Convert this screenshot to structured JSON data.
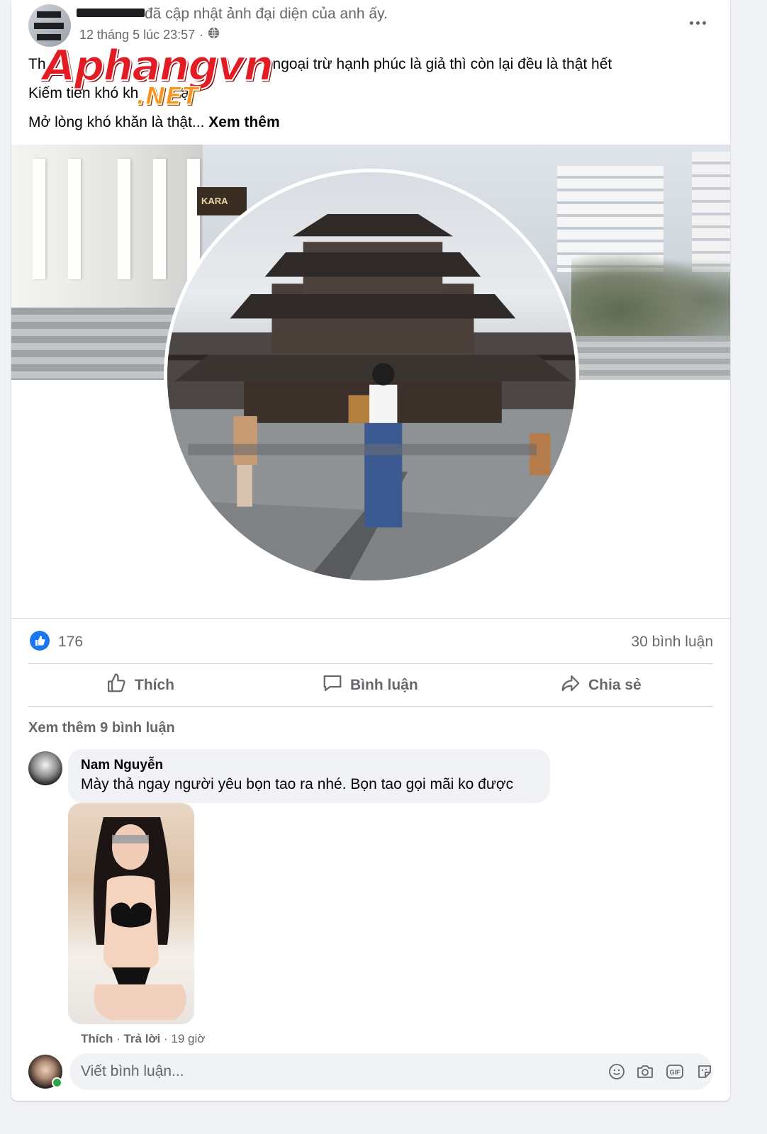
{
  "post": {
    "header_action": "đã cập nhật ảnh đại diện của anh ấy.",
    "timestamp": "12 tháng 5 lúc 23:57",
    "separator": "·",
    "audience_icon": "globe-icon",
    "more_icon": "more-horizontal-icon",
    "text_lines": [
      "ngoại trừ hạnh phúc là giả thì còn lại đều là thật hết",
      "Kiếm tiền khó kh",
      "ật",
      "Mở lòng khó khăn là thật..."
    ],
    "line1_prefix": "Th",
    "see_more": "Xem thêm"
  },
  "watermark": {
    "main": "Aphangvn",
    "suffix": ".NET"
  },
  "cover_photo": {
    "sign_text": "KARA"
  },
  "reactions": {
    "icon": "like-icon",
    "count": "176",
    "comments": "30 bình luận"
  },
  "actions": {
    "like": "Thích",
    "comment": "Bình luận",
    "share": "Chia sẻ"
  },
  "comments": {
    "view_more": "Xem thêm 9 bình luận",
    "items": [
      {
        "author": "Nam Nguyễn",
        "text": "Mày thả ngay người yêu bọn tao ra nhé. Bọn tao gọi mãi ko được",
        "like": "Thích",
        "reply": "Trả lời",
        "time": "19 giờ"
      }
    ]
  },
  "composer": {
    "placeholder": "Viết bình luận...",
    "icons": [
      "emoji-icon",
      "camera-icon",
      "gif-icon",
      "sticker-icon"
    ],
    "gif_label": "GIF"
  },
  "colors": {
    "accent": "#1877f2",
    "secondary_text": "#65676b",
    "bubble": "#f0f2f5",
    "online": "#31a24c"
  }
}
